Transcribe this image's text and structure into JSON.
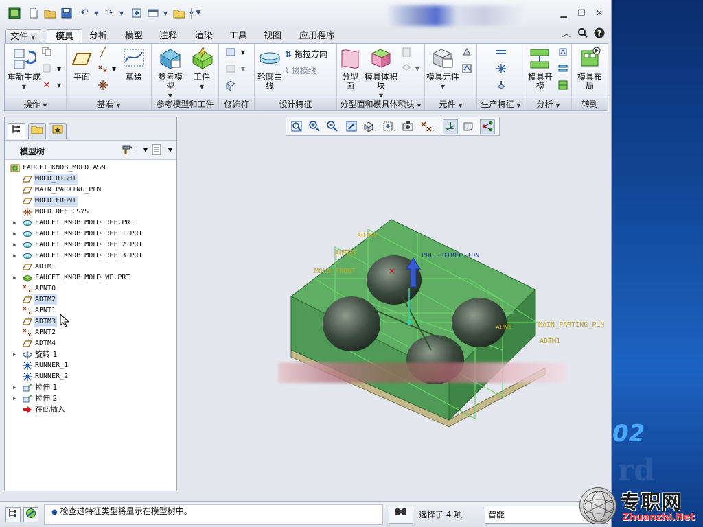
{
  "window": {
    "file_menu": "文件",
    "tabs": [
      "模具",
      "分析",
      "模型",
      "注释",
      "渲染",
      "工具",
      "视图",
      "应用程序"
    ],
    "active_tab": "模具"
  },
  "ribbon": {
    "groups": {
      "operations": "操作",
      "datum": "基准",
      "ref_model": "参考模型和工件",
      "modifiers": "修饰符",
      "design_features": "设计特征",
      "parting": "分型面和模具体积块",
      "components": "元件",
      "production": "生产特征",
      "analysis": "分析",
      "goto": "转到"
    },
    "buttons": {
      "regenerate": "重新生成",
      "plane": "平面",
      "sketch": "草绘",
      "ref_model": "参考模型",
      "workpiece": "工件",
      "contour_curve": "轮廓曲线",
      "drag_direction": "拖拉方向",
      "draft_line": "拔模线",
      "parting_surface": "分型面",
      "mold_volume": "模具体积块",
      "mold_component": "模具元件",
      "mold_open": "模具开模",
      "mold_layout": "模具布局"
    }
  },
  "model_tree": {
    "title": "模型树",
    "items": [
      {
        "label": "FAUCET_KNOB_MOLD.ASM",
        "icon": "assembly-icon",
        "level": 0,
        "expandable": false,
        "selected": false
      },
      {
        "label": "MOLD_RIGHT",
        "icon": "datum-plane-icon",
        "level": 1,
        "expandable": false,
        "selected": true
      },
      {
        "label": "MAIN_PARTING_PLN",
        "icon": "datum-plane-icon",
        "level": 1,
        "expandable": false,
        "selected": false
      },
      {
        "label": "MOLD_FRONT",
        "icon": "datum-plane-icon",
        "level": 1,
        "expandable": false,
        "selected": true
      },
      {
        "label": "MOLD_DEF_CSYS",
        "icon": "csys-icon",
        "level": 1,
        "expandable": false,
        "selected": false
      },
      {
        "label": "FAUCET_KNOB_MOLD_REF.PRT",
        "icon": "part-icon",
        "level": 1,
        "expandable": true,
        "selected": false
      },
      {
        "label": "FAUCET_KNOB_MOLD_REF_1.PRT",
        "icon": "part-icon",
        "level": 1,
        "expandable": true,
        "selected": false
      },
      {
        "label": "FAUCET_KNOB_MOLD_REF_2.PRT",
        "icon": "part-icon",
        "level": 1,
        "expandable": true,
        "selected": false
      },
      {
        "label": "FAUCET_KNOB_MOLD_REF_3.PRT",
        "icon": "part-icon",
        "level": 1,
        "expandable": true,
        "selected": false
      },
      {
        "label": "ADTM1",
        "icon": "datum-plane-icon",
        "level": 1,
        "expandable": false,
        "selected": false
      },
      {
        "label": "FAUCET_KNOB_MOLD_WP.PRT",
        "icon": "workpiece-icon",
        "level": 1,
        "expandable": true,
        "selected": false
      },
      {
        "label": "APNT0",
        "icon": "datum-point-icon",
        "level": 1,
        "expandable": false,
        "selected": false
      },
      {
        "label": "ADTM2",
        "icon": "datum-plane-icon",
        "level": 1,
        "expandable": false,
        "selected": true
      },
      {
        "label": "APNT1",
        "icon": "datum-point-icon",
        "level": 1,
        "expandable": false,
        "selected": false
      },
      {
        "label": "ADTM3",
        "icon": "datum-plane-icon",
        "level": 1,
        "expandable": false,
        "selected": true
      },
      {
        "label": "APNT2",
        "icon": "datum-point-icon",
        "level": 1,
        "expandable": false,
        "selected": false
      },
      {
        "label": "ADTM4",
        "icon": "datum-plane-icon",
        "level": 1,
        "expandable": false,
        "selected": false
      },
      {
        "label": "旋转 1",
        "icon": "revolve-icon",
        "level": 1,
        "expandable": true,
        "selected": false
      },
      {
        "label": "RUNNER_1",
        "icon": "runner-icon",
        "level": 1,
        "expandable": false,
        "selected": false
      },
      {
        "label": "RUNNER_2",
        "icon": "runner-icon",
        "level": 1,
        "expandable": false,
        "selected": false
      },
      {
        "label": "拉伸 1",
        "icon": "extrude-icon",
        "level": 1,
        "expandable": true,
        "selected": false
      },
      {
        "label": "拉伸 2",
        "icon": "extrude-icon",
        "level": 1,
        "expandable": true,
        "selected": false
      },
      {
        "label": "在此插入",
        "icon": "insert-here-icon",
        "level": 1,
        "expandable": false,
        "selected": false
      }
    ]
  },
  "viewport": {
    "labels": {
      "adtm2": "ADTM2",
      "adtm3": "ADTM3",
      "mold_front": "MOLD_FRONT",
      "pull_direction": "PULL DIRECTION",
      "main_parting": "MAIN_PARTING_PLN",
      "adtm1": "ADTM1",
      "apnt": "APNT"
    },
    "colors": {
      "mold_green": "#4f9a56",
      "mold_green_dark": "#2f6b36",
      "mold_base": "#c4b98a",
      "datum_green": "#6ad46a",
      "label_yellow": "#c8a81e",
      "pull_blue": "#1e3aa8"
    }
  },
  "status": {
    "message": "检查过特征类型将显示在模型树中。",
    "selection": "选择了 4 项",
    "filter_mode": "智能"
  },
  "watermark": {
    "cn": "专职网",
    "en": "Zhuanzhi.Net"
  },
  "desktop": {
    "number": "02",
    "ghost_text": "rd"
  }
}
